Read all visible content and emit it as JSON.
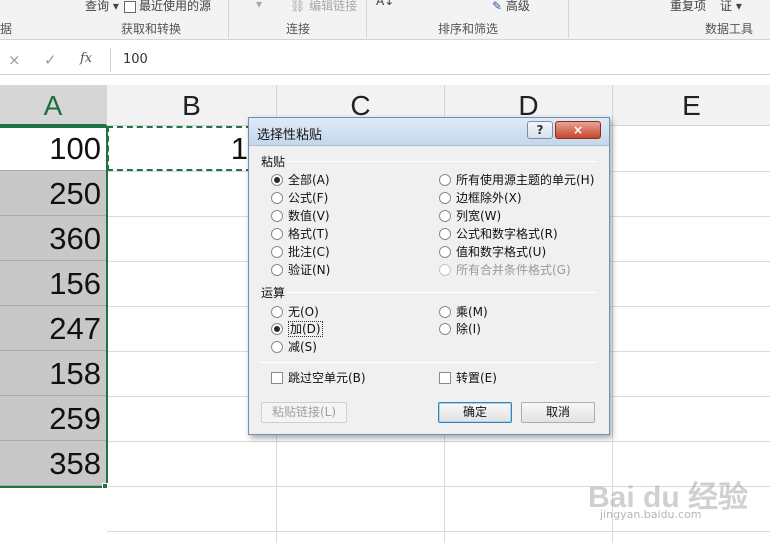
{
  "ribbon": {
    "query_label": "查询",
    "recent_sources_label": "最近使用的源",
    "edit_links_label": "编辑链接",
    "advanced_label": "高级",
    "remove_duplicates_label": "重复项",
    "validation_label": "证",
    "groups": {
      "get_transform_partial": "据",
      "get_transform": "获取和转换",
      "connections": "连接",
      "sort_filter": "排序和筛选",
      "data_tools": "数据工具"
    }
  },
  "formula_bar": {
    "cancel_icon": "×",
    "enter_icon": "✓",
    "fx_icon": "fx",
    "value": "100"
  },
  "columns": [
    "A",
    "B",
    "C",
    "D",
    "E"
  ],
  "column_a_values": [
    "100",
    "250",
    "360",
    "156",
    "247",
    "158",
    "259",
    "358"
  ],
  "b1_partial": "1",
  "dialog": {
    "title": "选择性粘贴",
    "help_label": "?",
    "close_label": "×",
    "paste_section": "粘贴",
    "paste_options_left": [
      "全部(A)",
      "公式(F)",
      "数值(V)",
      "格式(T)",
      "批注(C)",
      "验证(N)"
    ],
    "paste_options_right": [
      "所有使用源主题的单元(H)",
      "边框除外(X)",
      "列宽(W)",
      "公式和数字格式(R)",
      "值和数字格式(U)",
      "所有合并条件格式(G)"
    ],
    "operation_section": "运算",
    "operation_options_left": [
      "无(O)",
      "加(D)",
      "减(S)"
    ],
    "operation_options_right": [
      "乘(M)",
      "除(I)"
    ],
    "skip_blanks_label": "跳过空单元(B)",
    "transpose_label": "转置(E)",
    "paste_link_label": "粘贴链接(L)",
    "ok_label": "确定",
    "cancel_label": "取消"
  },
  "watermark": {
    "logo_text": "Bai du 经验",
    "url": "jingyan.baidu.com"
  }
}
